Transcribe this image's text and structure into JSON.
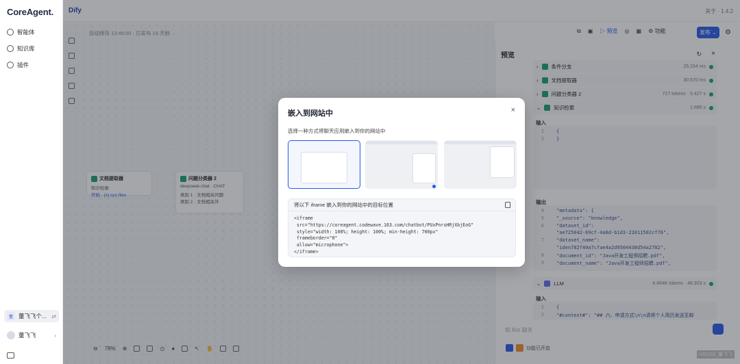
{
  "brand": "CoreAgent.",
  "nav": {
    "items": [
      {
        "label": "智能体",
        "icon": "agent-icon"
      },
      {
        "label": "知识库",
        "icon": "knowledge-icon"
      },
      {
        "label": "插件",
        "icon": "plugin-icon"
      }
    ]
  },
  "user": {
    "workspace": "董飞飞个...",
    "name": "董飞飞"
  },
  "topbar": {
    "app": "Dify",
    "about": "关于 · 1.4.2"
  },
  "workflow": {
    "autosave": "自动保存 13:48:50 · 已发布 16 天前",
    "nodes": [
      {
        "title": "文档提取器",
        "sub1": "知识检索",
        "sub2": "开始 · {x} sys.files"
      },
      {
        "title": "问题分类器 2",
        "sub1": "deepseek-chat · CHAT",
        "sub2": "类别 1 · 文档相关问题",
        "sub3": "类别 2 · 文档相关外"
      }
    ],
    "zoom": "78%"
  },
  "toolbar": {
    "preview": "预览",
    "features": "功能",
    "publish": "发布"
  },
  "preview": {
    "title": "预览",
    "tracks": [
      {
        "label": "条件分支",
        "meta": "25.154 ms"
      },
      {
        "label": "文档提取器",
        "meta": "30.570 ms"
      },
      {
        "label": "问题分类器 2",
        "meta": "727 tokens · 5.427 s"
      },
      {
        "label": "知识检索",
        "meta": "1.685 s"
      }
    ],
    "input_label": "输入",
    "input_code": [
      "{",
      "}"
    ],
    "output_label": "输出",
    "output_code": [
      {
        "ln": "4",
        "text": "\"metadata\": {"
      },
      {
        "ln": "5",
        "text": "  \"_source\": \"knowledge\","
      },
      {
        "ln": "6",
        "text": "  \"dataset_id\":"
      },
      {
        "ln": "",
        "text": "  \"ae725042-69cf-4a8d-b1d3-22011502cf76\","
      },
      {
        "ln": "7",
        "text": "  \"dataset_name\":"
      },
      {
        "ln": "",
        "text": "  \"iden782f40a7cfae4a2d9504438d54a2782\","
      },
      {
        "ln": "8",
        "text": "  \"document_id\": \"Java开发工程师招聘.pdf\","
      },
      {
        "ln": "9",
        "text": "  \"document_name\": \"Java开发工程师招聘.pdf\","
      }
    ],
    "llm": {
      "label": "LLM",
      "meta": "4.464K tokens · 48.923 s"
    },
    "llm_input_label": "输入",
    "llm_code": [
      {
        "ln": "1",
        "text": "{"
      },
      {
        "ln": "2",
        "text": "  \"#context#\": \"## 六、申请方式\\n\\n请将个人简历发送至邮"
      }
    ],
    "chat_placeholder": "和 Bot 聊天",
    "feature_tag": "功能已开启",
    "footnote": "H31153_董飞飞"
  },
  "modal": {
    "title": "嵌入到网站中",
    "close": "×",
    "description": "选择一种方式将聊天应用嵌入到你的网站中",
    "embed_label": "将以下 iframe 嵌入到你的网站中的目标位置",
    "code": "<iframe\n src=\"https://coreagent.codewave.163.com/chatbot/PUxPnrsHRjXbjEoG\"\n style=\"width: 100%; height: 100%; min-height: 700px\"\n frameborder=\"0\"\n allow=\"microphone\">\n</iframe>"
  }
}
